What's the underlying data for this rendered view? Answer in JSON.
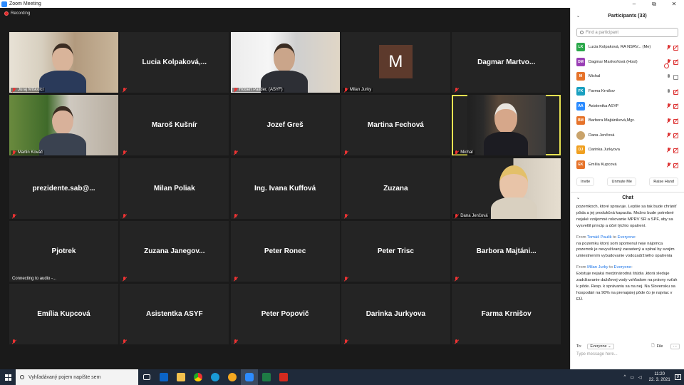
{
  "window": {
    "title": "Zoom Meeting",
    "minimize": "–",
    "maximize": "⧉",
    "close": "✕"
  },
  "recording": {
    "label": "Recording"
  },
  "colors": {
    "accent": "#2d8cff",
    "active_speaker": "#e8e352",
    "muted_red": "#e33333"
  },
  "tiles": [
    {
      "label": "Juraj Miškolci",
      "type": "video"
    },
    {
      "name": "Lucia  Kolpaková,...",
      "type": "name"
    },
    {
      "label": "Róbert Palider, (ASYF)",
      "type": "video"
    },
    {
      "label": "Milan Jurky",
      "avatar_letter": "M",
      "type": "avatar"
    },
    {
      "name": "Dagmar  Martvo...",
      "type": "name"
    },
    {
      "label": "Martin Kováč",
      "type": "video"
    },
    {
      "name": "Maroš Kušnír",
      "type": "name"
    },
    {
      "name": "Jozef Greš",
      "type": "name"
    },
    {
      "name": "Martina Fechová",
      "type": "name"
    },
    {
      "label": "Michal",
      "type": "video",
      "active": true
    },
    {
      "name": "prezidente.sab@...",
      "type": "name"
    },
    {
      "name": "Milan Poliak",
      "type": "name"
    },
    {
      "name": "Ing. Ivana Kuffová",
      "type": "name"
    },
    {
      "name": "Zuzana",
      "type": "name"
    },
    {
      "label": "Dana Jenčová",
      "type": "video"
    },
    {
      "name": "Pjotrek",
      "label": "Connecting to audio -...",
      "type": "name"
    },
    {
      "name": "Zuzana  Janegov...",
      "type": "name"
    },
    {
      "name": "Peter Ronec",
      "type": "name"
    },
    {
      "name": "Peter Trisc",
      "type": "name"
    },
    {
      "name": "Barbora  Majtáni...",
      "type": "name"
    },
    {
      "name": "Emília Kupcová",
      "type": "name"
    },
    {
      "name": "Asistentka ASYF",
      "type": "name"
    },
    {
      "name": "Peter Popovič",
      "type": "name"
    },
    {
      "name": "Darinka Jurkyova",
      "type": "name"
    },
    {
      "name": "Farma Krnišov",
      "type": "name"
    }
  ],
  "participants": {
    "title": "Participants (33)",
    "search_placeholder": "Find a participant",
    "items": [
      {
        "initials": "LK",
        "name": "Lucia Kolpaková, RA NSRV... (Me)",
        "color": "#2aa84a",
        "icons": [
          "mic-muted",
          "video-off"
        ]
      },
      {
        "initials": "DM",
        "name": "Dagmar Martvoňová (Host)",
        "color": "#9a3fb5",
        "icons": [
          "rec",
          "mic-muted",
          "video-off"
        ]
      },
      {
        "initials": "M",
        "name": "Michal",
        "color": "#e6732a",
        "icons": [
          "mic-on",
          "video-on"
        ]
      },
      {
        "initials": "FK",
        "name": "Farma Krnišov",
        "color": "#1aa0c0",
        "icons": [
          "mic-on",
          "video-off"
        ]
      },
      {
        "initials": "AA",
        "name": "Asistentka ASYF",
        "color": "#2d8cff",
        "icons": [
          "mic-muted",
          "video-off"
        ]
      },
      {
        "initials": "BM",
        "name": "Barbora Majtániková,Mgr.",
        "color": "#e6732a",
        "icons": [
          "mic-muted",
          "video-off"
        ]
      },
      {
        "initials": "",
        "name": "Dana Jenčová",
        "color": "#c9a36b",
        "icons": [
          "mic-muted",
          "video-off"
        ]
      },
      {
        "initials": "DJ",
        "name": "Darinka Jurkyova",
        "color": "#f0a020",
        "icons": [
          "mic-muted",
          "video-off"
        ]
      },
      {
        "initials": "EK",
        "name": "Emília Kupcová",
        "color": "#e6732a",
        "icons": [
          "mic-muted",
          "video-off"
        ]
      }
    ],
    "buttons": {
      "invite": "Invite",
      "unmute": "Unmute Me",
      "raise": "Raise Hand"
    }
  },
  "chat": {
    "title": "Chat",
    "messages": [
      {
        "from": "",
        "to": "",
        "text": "pozemkoch, ktoré spravuje. Lepšie sa tak bude chrániť pôda a jej produkčná kapacita. Možno bude potrebné nejaké vzájomné rokovanie MPRV SR a SPF, aby sa vysvetlil princíp a účel týchto opatrení."
      },
      {
        "from": "Tomáš Paulik",
        "to": "Everyone",
        "text": "na pozemku ktorý som spomenul neje nájomca pozemok je nevyužívaný zarastený a splnal by svojim umiestnením vybudovanie vodozadržného opatrenia"
      },
      {
        "from": "Milan Jurky",
        "to": "Everyone",
        "text": "Existuje nejaká medzinárodná štúdia ,ktorá sleduje zadržiavanie dažďovej vody vzhľadom na právny vzťah k pôde. Resp. k správaniu sa na nej.  Na Slovensku sa hospodári na 90% na prenajatej pôde čo je najviac v EÚ."
      }
    ],
    "from_word": "From",
    "to_word": "to",
    "to_label": "To:",
    "to_value": "Everyone",
    "file_label": "File",
    "more_label": "···",
    "input_placeholder": "Type message here..."
  },
  "taskbar": {
    "search_placeholder": "Vyhľadávaný pojem napíšte sem",
    "time": "11:20",
    "date": "22. 3. 2021",
    "notification_count": "9"
  }
}
